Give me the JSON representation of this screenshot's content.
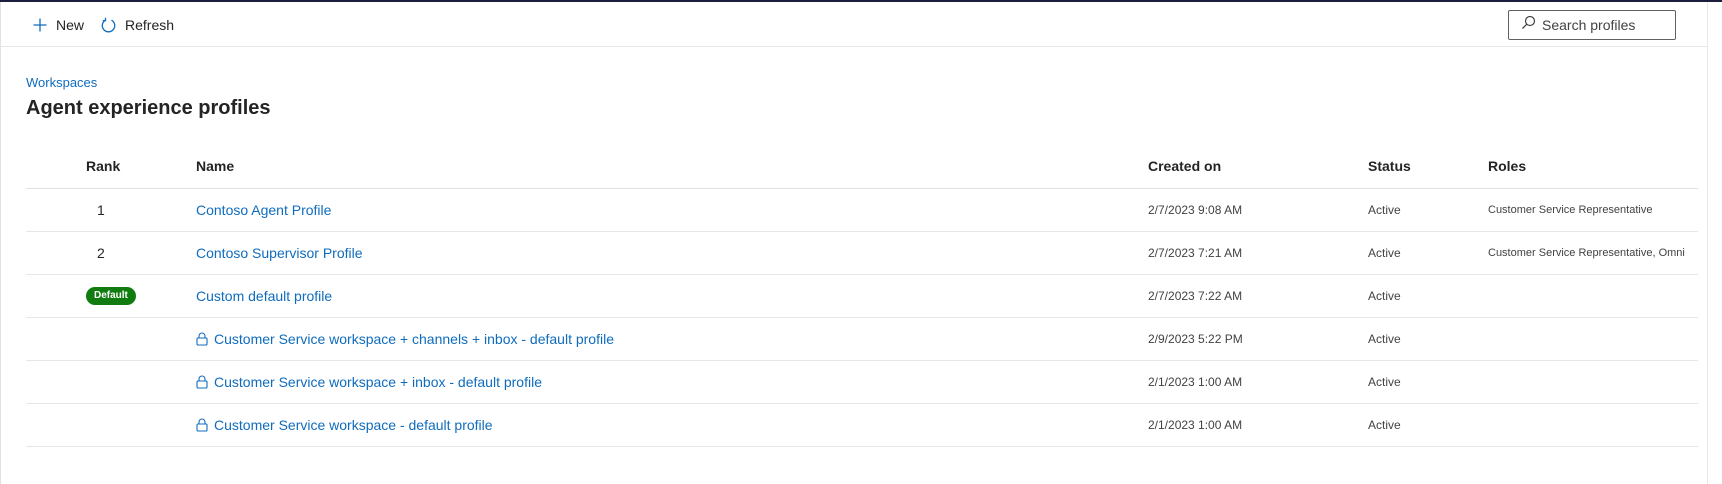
{
  "toolbar": {
    "new_label": "New",
    "refresh_label": "Refresh",
    "search_placeholder": "Search profiles"
  },
  "header": {
    "breadcrumb": "Workspaces",
    "title": "Agent experience profiles"
  },
  "grid": {
    "columns": {
      "rank": "Rank",
      "name": "Name",
      "created_on": "Created on",
      "status": "Status",
      "roles": "Roles"
    },
    "rows": [
      {
        "rank": "1",
        "name": "Contoso Agent Profile",
        "created_on": "2/7/2023 9:08 AM",
        "status": "Active",
        "roles": "Customer Service Representative"
      },
      {
        "rank": "2",
        "name": "Contoso Supervisor Profile",
        "created_on": "2/7/2023 7:21 AM",
        "status": "Active",
        "roles": "Customer Service Representative, Omni"
      },
      {
        "badge": "Default",
        "name": "Custom default profile",
        "created_on": "2/7/2023 7:22 AM",
        "status": "Active",
        "roles": ""
      },
      {
        "locked": true,
        "name": "Customer Service workspace + channels + inbox - default profile",
        "created_on": "2/9/2023 5:22 PM",
        "status": "Active",
        "roles": ""
      },
      {
        "locked": true,
        "name": "Customer Service workspace + inbox - default profile",
        "created_on": "2/1/2023 1:00 AM",
        "status": "Active",
        "roles": ""
      },
      {
        "locked": true,
        "name": "Customer Service workspace - default profile",
        "created_on": "2/1/2023 1:00 AM",
        "status": "Active",
        "roles": ""
      }
    ]
  },
  "icons": {
    "new": "plus-icon",
    "refresh": "refresh-icon",
    "search": "search-icon",
    "lock": "lock-icon"
  },
  "colors": {
    "link": "#0f6cbd",
    "default_badge": "#107c10",
    "top_border": "#1b1f3b"
  }
}
